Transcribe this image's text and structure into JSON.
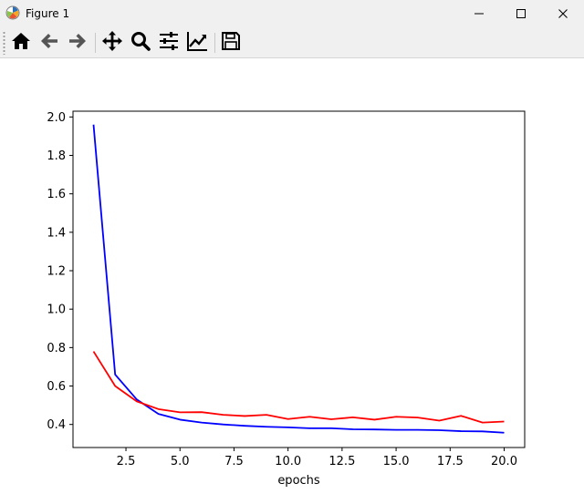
{
  "window": {
    "title": "Figure 1",
    "controls": [
      "minimize-icon",
      "maximize-icon",
      "close-icon"
    ]
  },
  "toolbar": {
    "buttons": [
      {
        "name": "home",
        "icon": "home-icon"
      },
      {
        "name": "back",
        "icon": "arrow-left-icon"
      },
      {
        "name": "forward",
        "icon": "arrow-right-icon"
      },
      {
        "name": "pan",
        "icon": "move-icon"
      },
      {
        "name": "zoom",
        "icon": "magnifier-icon"
      },
      {
        "name": "configure-subplots",
        "icon": "sliders-icon"
      },
      {
        "name": "edit-axis",
        "icon": "chart-line-icon"
      },
      {
        "name": "save",
        "icon": "floppy-disk-icon"
      }
    ]
  },
  "chart_data": {
    "type": "line",
    "title": "",
    "xlabel": "epochs",
    "ylabel": "",
    "xlim": [
      0.05,
      20.95
    ],
    "ylim": [
      0.28,
      2.03
    ],
    "xticks": [
      2.5,
      5.0,
      7.5,
      10.0,
      12.5,
      15.0,
      17.5,
      20.0
    ],
    "xtick_labels": [
      "2.5",
      "5.0",
      "7.5",
      "10.0",
      "12.5",
      "15.0",
      "17.5",
      "20.0"
    ],
    "yticks": [
      0.4,
      0.6,
      0.8,
      1.0,
      1.2,
      1.4,
      1.6,
      1.8,
      2.0
    ],
    "ytick_labels": [
      "0.4",
      "0.6",
      "0.8",
      "1.0",
      "1.2",
      "1.4",
      "1.6",
      "1.8",
      "2.0"
    ],
    "grid": false,
    "legend": "none",
    "x": [
      1,
      2,
      3,
      4,
      5,
      6,
      7,
      8,
      9,
      10,
      11,
      12,
      13,
      14,
      15,
      16,
      17,
      18,
      19,
      20
    ],
    "series": [
      {
        "color": "#0000ff",
        "values": [
          1.96,
          0.66,
          0.53,
          0.455,
          0.425,
          0.41,
          0.4,
          0.393,
          0.388,
          0.385,
          0.38,
          0.38,
          0.375,
          0.374,
          0.372,
          0.372,
          0.37,
          0.365,
          0.364,
          0.357
        ]
      },
      {
        "color": "#ff0000",
        "values": [
          0.78,
          0.6,
          0.52,
          0.48,
          0.463,
          0.464,
          0.45,
          0.444,
          0.45,
          0.428,
          0.44,
          0.427,
          0.437,
          0.425,
          0.44,
          0.436,
          0.42,
          0.445,
          0.41,
          0.415
        ]
      }
    ]
  }
}
